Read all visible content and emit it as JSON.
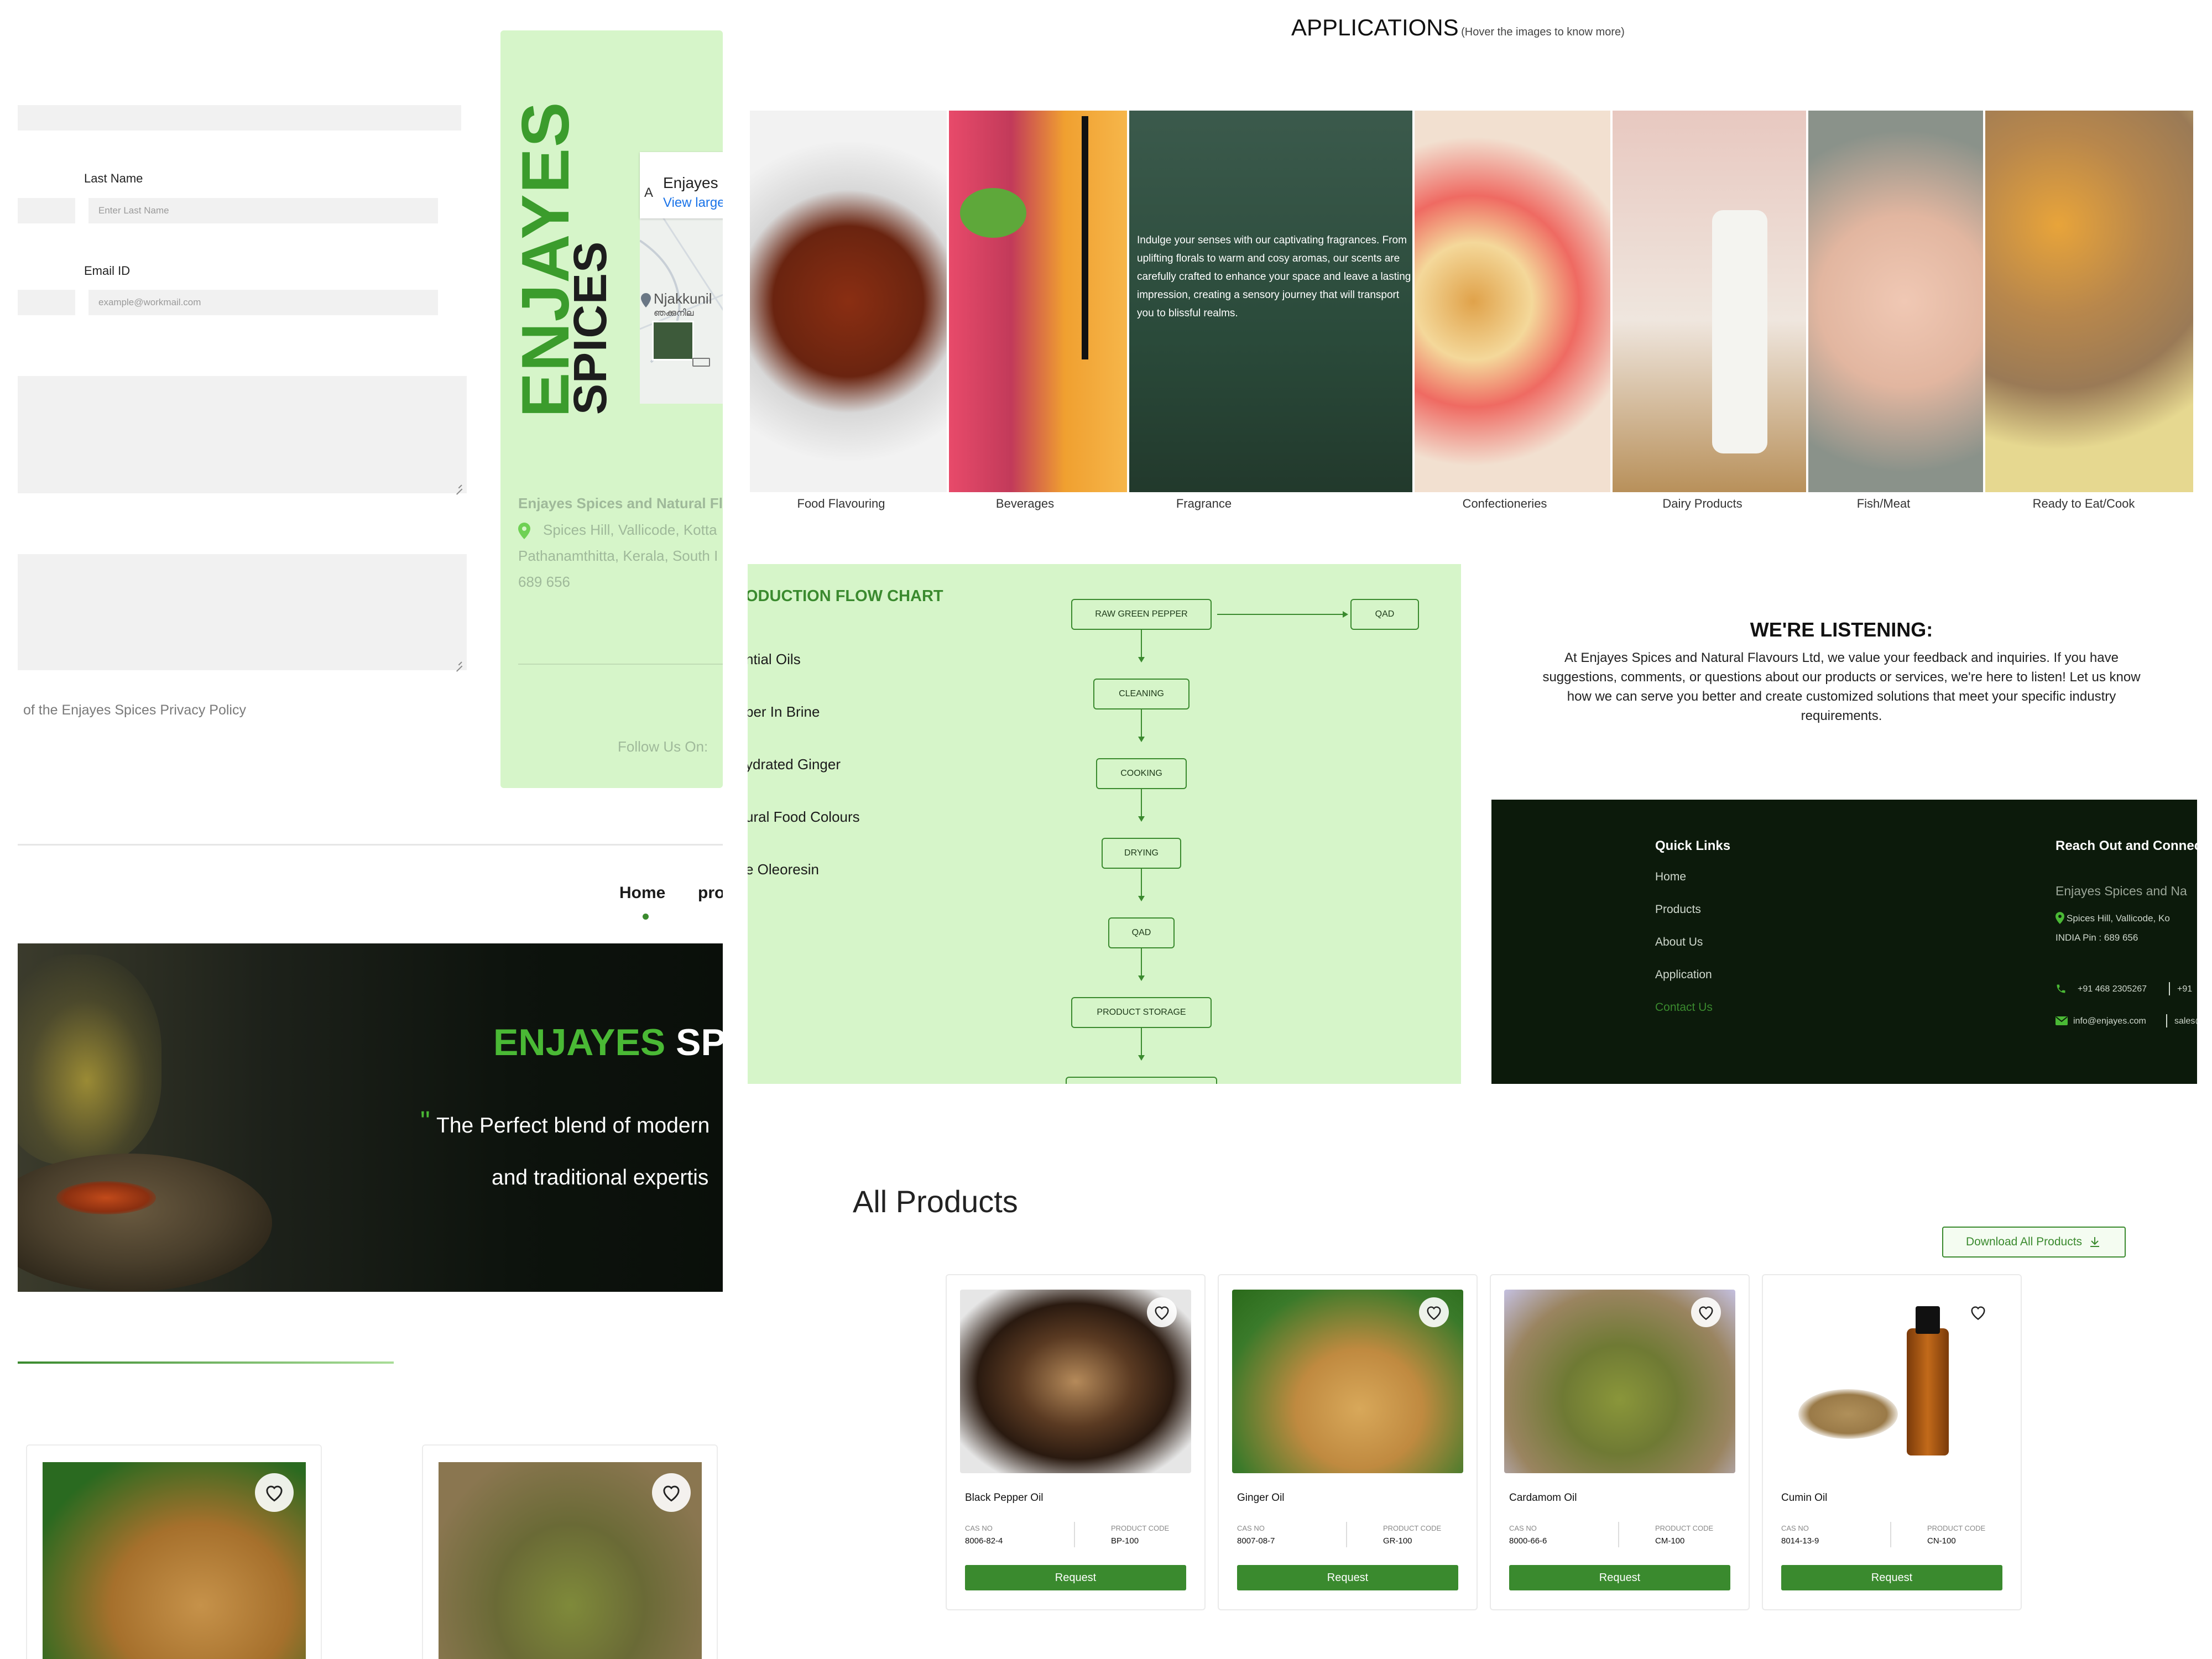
{
  "form": {
    "last_name_label": "Last Name",
    "last_name_placeholder": "Enter Last Name",
    "email_label": "Email ID",
    "email_placeholder": "example@workmail.com",
    "privacy_text": "of the Enjayes Spices Privacy Policy"
  },
  "brand_card": {
    "logo_line1": "ENJAYES",
    "logo_line2": "SPICES",
    "map_title": "Enjayes S",
    "map_link": "View large",
    "map_place": "Njakkunil",
    "map_place_local": "ഞക്കുനില",
    "map_letter": "A",
    "company": "Enjayes Spices and Natural Fla",
    "address_line1": "Spices Hill, Vallicode, Kotta",
    "address_line2": "Pathanamthitta, Kerala, South I",
    "address_line3": "689 656",
    "follow": "Follow Us On:"
  },
  "nav": {
    "home": "Home",
    "products": "pro"
  },
  "hero": {
    "brand_green": "ENJAYES",
    "brand_white": "SPIC",
    "quote_mark": "\"",
    "tagline_line1": "The Perfect blend of modern",
    "tagline_line2": "and traditional expertis"
  },
  "applications": {
    "title": "APPLICATIONS",
    "subtitle": "(Hover the images to know more)",
    "fragrance_text": "Indulge your senses with our captivating fragrances. From uplifting florals to warm and cosy aromas, our scents are carefully crafted to enhance your space and leave a lasting impression, creating a sensory journey that will transport you to blissful realms.",
    "items": [
      {
        "label": "Food Flavouring"
      },
      {
        "label": "Beverages"
      },
      {
        "label": "Fragrance"
      },
      {
        "label": "Confectioneries"
      },
      {
        "label": "Dairy Products"
      },
      {
        "label": "Fish/Meat"
      },
      {
        "label": "Ready to Eat/Cook"
      }
    ]
  },
  "flowchart": {
    "title": "ODUCTION FLOW CHART",
    "list": [
      "ntial Oils",
      "per In Brine",
      "ydrated Ginger",
      "ural Food Colours",
      "e Oleoresin"
    ],
    "steps": [
      "RAW GREEN PEPPER",
      "CLEANING",
      "COOKING",
      "DRYING",
      "QAD",
      "PRODUCT STORAGE"
    ],
    "side_step": "QAD"
  },
  "listening": {
    "title": "WE'RE LISTENING:",
    "line1": "At Enjayes Spices and Natural Flavours Ltd, we value your feedback and inquiries. If you have",
    "line2": "suggestions, comments, or questions about our products or services, we're here to listen! Let us know",
    "line3": "how we can serve you better and create customized solutions that meet your specific industry",
    "line4": "requirements."
  },
  "footer": {
    "quick_links_title": "Quick Links",
    "links": [
      "Home",
      "Products",
      "About Us",
      "Application",
      "Contact Us"
    ],
    "reach_title": "Reach Out and Connec",
    "company": "Enjayes Spices and Na",
    "address1": "Spices Hill, Vallicode, Ko",
    "address2": "INDIA Pin : 689 656",
    "phone1": "+91 468 2305267",
    "phone2": "+91",
    "email1": "info@enjayes.com",
    "email2": "sales@",
    "accent": "#3a8a2e"
  },
  "products": {
    "title": "All Products",
    "download_label": "Download All Products",
    "cas_label": "CAS NO",
    "code_label": "PRODUCT CODE",
    "request_label": "Request",
    "items": [
      {
        "name": "Black Pepper Oil",
        "cas": "8006-82-4",
        "code": "BP-100"
      },
      {
        "name": "Ginger Oil",
        "cas": "8007-08-7",
        "code": "GR-100"
      },
      {
        "name": "Cardamom Oil",
        "cas": "8000-66-6",
        "code": "CM-100"
      },
      {
        "name": "Cumin Oil",
        "cas": "8014-13-9",
        "code": "CN-100"
      }
    ]
  }
}
